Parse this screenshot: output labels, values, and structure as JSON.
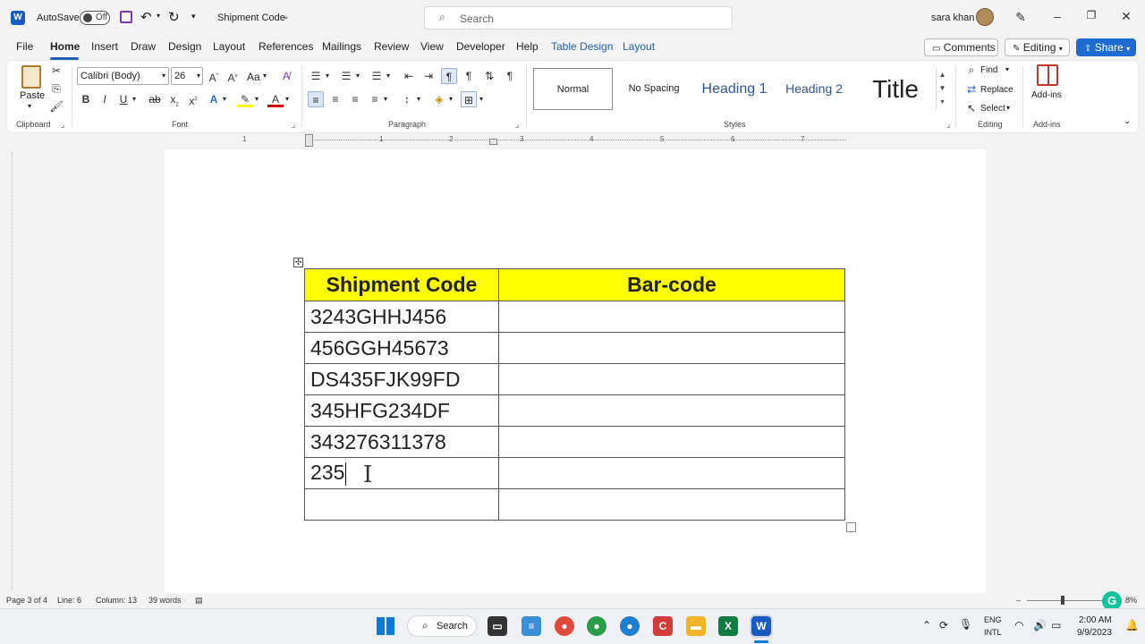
{
  "title_bar": {
    "autosave_label": "AutoSave",
    "autosave_state": "Off",
    "document_title": "Shipment Code",
    "search_placeholder": "Search",
    "user_name": "sara khan"
  },
  "menu_tabs": [
    "File",
    "Home",
    "Insert",
    "Draw",
    "Design",
    "Layout",
    "References",
    "Mailings",
    "Review",
    "View",
    "Developer",
    "Help",
    "Table Design",
    "Layout"
  ],
  "actions": {
    "comments": "Comments",
    "editing": "Editing",
    "share": "Share"
  },
  "ribbon": {
    "clipboard": {
      "paste": "Paste",
      "label": "Clipboard"
    },
    "font": {
      "name": "Calibri (Body)",
      "size": "26",
      "case": "Aa",
      "label": "Font"
    },
    "paragraph": {
      "label": "Paragraph"
    },
    "styles": {
      "items": [
        "Normal",
        "No Spacing",
        "Heading 1",
        "Heading 2",
        "Title"
      ],
      "label": "Styles"
    },
    "editing": {
      "find": "Find",
      "replace": "Replace",
      "select": "Select",
      "label": "Editing"
    },
    "addins": {
      "button": "Add-ins",
      "label": "Add-ins"
    }
  },
  "ruler_numbers": [
    "1",
    "1",
    "2",
    "3",
    "4",
    "5",
    "6",
    "7"
  ],
  "table": {
    "headers": [
      "Shipment Code",
      "Bar-code"
    ],
    "rows": [
      [
        "3243GHHJ456",
        ""
      ],
      [
        "456GGH45673",
        ""
      ],
      [
        "DS435FJK99FD",
        ""
      ],
      [
        "345HFG234DF",
        ""
      ],
      [
        "343276311378",
        ""
      ],
      [
        "235",
        ""
      ],
      [
        "",
        ""
      ]
    ]
  },
  "status_bar": {
    "page": "Page 3 of 4",
    "line": "Line: 6",
    "column": "Column: 13",
    "words": "39 words",
    "zoom_partial": "8%"
  },
  "taskbar": {
    "search_label": "Search",
    "lang_top": "ENG",
    "lang_bottom": "INTL",
    "time": "2:00 AM",
    "date": "9/9/2023"
  },
  "colors": {
    "accent": "#1f6bcf",
    "header_fill": "#ffff00",
    "word_blue": "#185abd",
    "excel_green": "#107c41"
  }
}
